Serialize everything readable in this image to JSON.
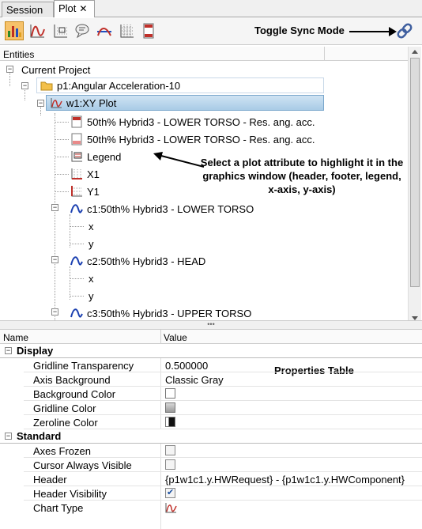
{
  "tabs": [
    {
      "label": "Session"
    },
    {
      "label": "Plot",
      "close": "✕"
    }
  ],
  "toolbar": {
    "toggle_label": "Toggle Sync Mode"
  },
  "entities": {
    "header": "Entities",
    "tree": {
      "project": "Current Project",
      "page": "p1:Angular Acceleration-10",
      "plot": "w1:XY Plot",
      "header_item": "50th% Hybrid3   - LOWER TORSO - Res. ang. acc.",
      "footer_item": "50th% Hybrid3   - LOWER TORSO - Res. ang. acc.",
      "legend": "Legend",
      "x1": "X1",
      "y1": "Y1",
      "c1": "c1:50th% Hybrid3   - LOWER TORSO",
      "c1_x": "x",
      "c1_y": "y",
      "c2": "c2:50th% Hybrid3   - HEAD",
      "c2_x": "x",
      "c2_y": "y",
      "c3": "c3:50th% Hybrid3   - UPPER TORSO"
    },
    "callout": "Select a plot attribute to highlight it in the graphics window (header, footer, legend, x-axis, y-axis)"
  },
  "properties": {
    "col_name": "Name",
    "col_value": "Value",
    "label": "Properties Table",
    "groups": [
      {
        "name": "Display",
        "rows": [
          {
            "name": "Gridline Transparency",
            "value": "0.500000"
          },
          {
            "name": "Axis Background",
            "value": "Classic Gray"
          },
          {
            "name": "Background Color",
            "swatch": "#ffffff"
          },
          {
            "name": "Gridline Color",
            "swatch": "#bfbfbf"
          },
          {
            "name": "Zeroline Color",
            "swatch": "#111111"
          }
        ]
      },
      {
        "name": "Standard",
        "rows": [
          {
            "name": "Axes Frozen",
            "checked": false
          },
          {
            "name": "Cursor Always Visible",
            "checked": false
          },
          {
            "name": "Header",
            "value": "{p1w1c1.y.HWRequest} - {p1w1c1.y.HWComponent}"
          },
          {
            "name": "Header Visibility",
            "checked": true
          },
          {
            "name": "Chart Type",
            "icon": "xy-chart-icon"
          }
        ]
      }
    ]
  },
  "colors": {
    "accent_curve": "#1a3fb0",
    "xy_icon": "#c0302a",
    "selection": "#b9d4ec"
  }
}
